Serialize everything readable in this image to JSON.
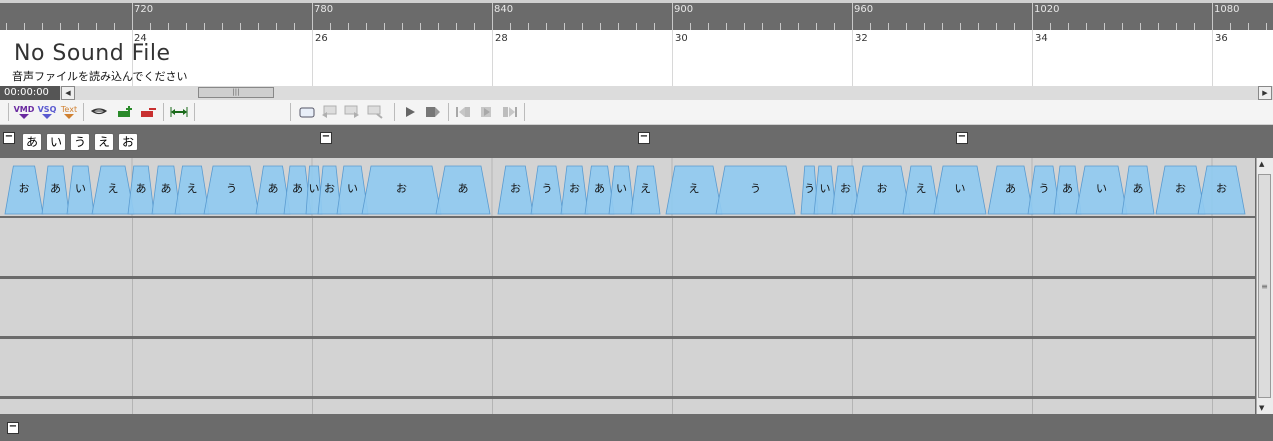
{
  "ruler": {
    "labels": [
      "720",
      "780",
      "840",
      "900",
      "960",
      "1020",
      "1080"
    ]
  },
  "wave": {
    "beat_numbers": [
      "24",
      "26",
      "28",
      "30",
      "32",
      "34",
      "36"
    ],
    "title": "No Sound File",
    "subtitle": "音声ファイルを読み込んでください"
  },
  "timebar": {
    "time": "00:00:00",
    "left_arrow": "◀",
    "right_arrow": "▶",
    "thumb_grip": "|||"
  },
  "toolbar": {
    "vmd_label": "VMD",
    "vsq_label": "VSQ",
    "text_label": "Text"
  },
  "track": {
    "collapse_symbol": "−",
    "vowels": [
      "あ",
      "い",
      "う",
      "え",
      "お"
    ]
  },
  "syllables": [
    "お",
    "あ",
    "い",
    "え",
    "あ",
    "あ",
    "え",
    "う",
    "あ",
    "あ",
    "い",
    "お",
    "い",
    "お",
    "あ",
    "お",
    "う",
    "お",
    "あ",
    "い",
    "え",
    "え",
    "う",
    "う",
    "い",
    "お",
    "お",
    "え",
    "い",
    "あ",
    "う",
    "あ",
    "い",
    "あ",
    "お",
    "お"
  ],
  "colors": {
    "syllable_fill": "#90caf0",
    "syllable_stroke": "#5a9bd0",
    "background": "#6b6b6b",
    "lane": "#d3d3d3"
  },
  "scroll": {
    "up_arrow": "▲",
    "down_arrow": "▼",
    "grip": "≡"
  }
}
